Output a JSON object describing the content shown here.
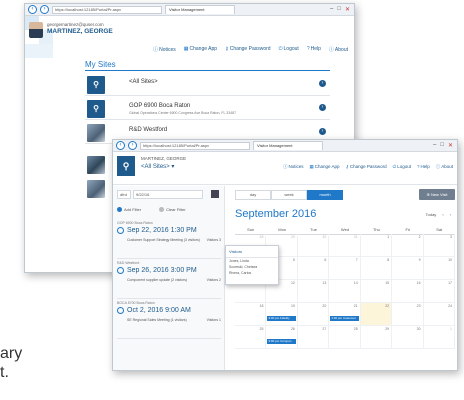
{
  "back_window": {
    "url": "https://localhost:12185/Portal/Pr.aspx",
    "tab_title": "Visitor Management",
    "user_email": "georgemartinez@quser.com",
    "user_name": "MARTINEZ, GEORGE",
    "nav": [
      {
        "icon": "info-icon",
        "label": "Notices"
      },
      {
        "icon": "app-icon",
        "label": "Change App"
      },
      {
        "icon": "key-icon",
        "label": "Change Password"
      },
      {
        "icon": "logout-icon",
        "label": "Logout"
      },
      {
        "icon": "help-icon",
        "label": "Help"
      },
      {
        "icon": "about-icon",
        "label": "About"
      }
    ],
    "sites_title": "My Sites",
    "sites": [
      {
        "name": "<All Sites>",
        "address": ""
      },
      {
        "name": "GOP 6900 Boca Raton",
        "address": "Global Operations Center 6900 Congress Ave Boca Raton, FL 33487"
      },
      {
        "name": "R&D Westford",
        "address": ""
      }
    ]
  },
  "front_window": {
    "url": "https://localhost:12185/Portal/Pr.aspx",
    "tab_title": "Visitor Management",
    "user_name": "MARTINEZ, GEORGE",
    "site_selector": "<All Sites>",
    "nav": [
      {
        "icon": "info-icon",
        "label": "Notices"
      },
      {
        "icon": "app-icon",
        "label": "Change App"
      },
      {
        "icon": "key-icon",
        "label": "Change Password"
      },
      {
        "icon": "logout-icon",
        "label": "Logout"
      },
      {
        "icon": "help-icon",
        "label": "Help"
      },
      {
        "icon": "about-icon",
        "label": "About"
      }
    ],
    "date_from": "9/22/16",
    "date_label": "dfrd",
    "add_filter": "Add Filter",
    "clear_filter": "Clear Filter",
    "visits": [
      {
        "site": "GOP 6900 Boca Raton",
        "time": "Sep 22, 2016 1:30 PM",
        "title": "Customer Support Strategy Meeting (3 visitors)",
        "count": "Visitors 3"
      },
      {
        "site": "R&D Westford",
        "time": "Sep 26, 2016 3:00 PM",
        "title": "Component supplier update (2 visitors)",
        "count": "Visitors 2"
      },
      {
        "site": "BOCA 5700 Boca Raton",
        "time": "Oct 2, 2016 9:00 AM",
        "title": "SE Regional Sales Meeting (1 visitors)",
        "count": "Visitors 1"
      }
    ],
    "view_tabs": [
      "day",
      "week",
      "month"
    ],
    "active_view": "month",
    "new_visit": "New Visit",
    "month_title": "September 2016",
    "today_label": "Today",
    "weekdays": [
      "Sun",
      "Mon",
      "Tue",
      "Wed",
      "Thu",
      "Fri",
      "Sat"
    ],
    "popover": {
      "title": "Visitors",
      "lines": [
        "Jones, Linda",
        "Scoreski, Chelsea",
        "Rivera, Carlos"
      ]
    },
    "events": [
      {
        "day": "19",
        "label": "3:00 pm Fidelity"
      },
      {
        "day": "21",
        "label": "1:30 pm Customer"
      },
      {
        "day": "26",
        "label": "3:00 pm Compon"
      },
      {
        "day": "2",
        "label": "9:00 am SE Reg"
      }
    ]
  },
  "caption": {
    "line1": "ary",
    "line2": "t."
  }
}
